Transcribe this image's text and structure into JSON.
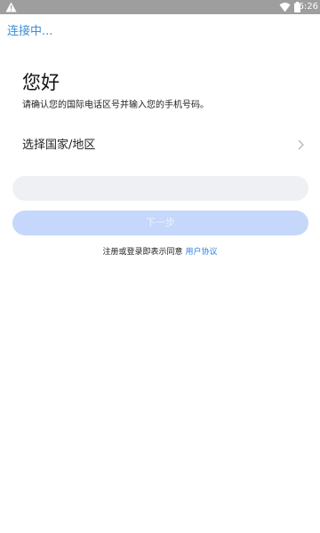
{
  "status_bar": {
    "time": "6:26",
    "icons": [
      "warning-icon",
      "wifi-icon",
      "battery-icon"
    ]
  },
  "header": {
    "connecting_text": "连接中..."
  },
  "main": {
    "greeting": "您好",
    "hint": "请确认您的国际电话区号并输入您的手机号码。",
    "country_selector_label": "选择国家/地区",
    "phone_input_placeholder": "",
    "next_button_label": "下一步",
    "agreement_text": "注册或登录即表示同意",
    "agreement_link": "用户协议"
  },
  "colors": {
    "status_bar": "#9e9e9e",
    "accent": "#3b8fd6",
    "link": "#2f7fe0",
    "button_disabled": "#c5d8fb",
    "input_bg": "#eef0f3"
  }
}
